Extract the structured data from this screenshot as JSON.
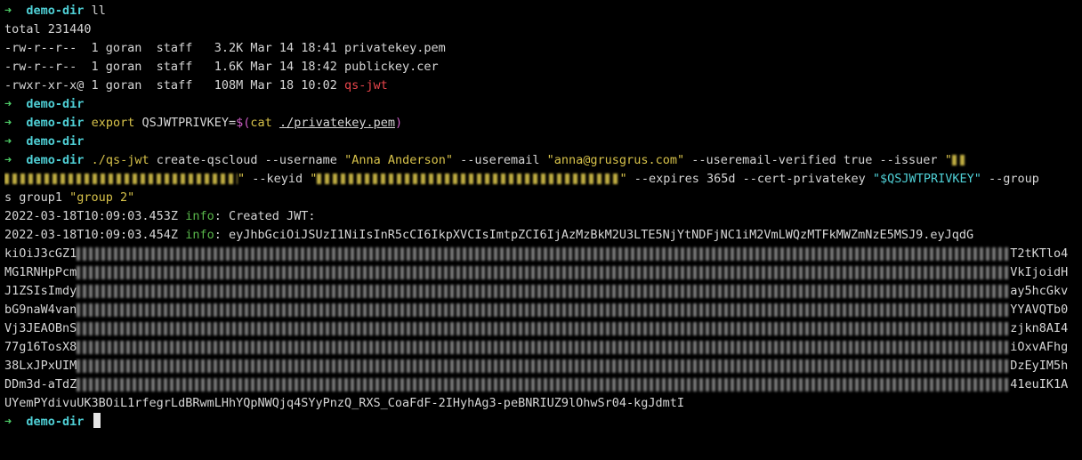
{
  "prompt": {
    "arrow": "➜",
    "dir": "demo-dir"
  },
  "colors": {
    "background": "#000000",
    "prompt_arrow": "#4fd06a",
    "prompt_dir": "#4fd0d6",
    "string": "#d7c24a",
    "variable": "#4fd0d6",
    "executable": "#e8454b",
    "info": "#59b74a"
  },
  "ls": {
    "command": "ll",
    "total": "total 231440",
    "rows": [
      {
        "perm": "-rw-r--r--  1 goran  staff   3.2K Mar 14 18:41 ",
        "name": "privatekey.pem"
      },
      {
        "perm": "-rw-r--r--  1 goran  staff   1.6K Mar 14 18:42 ",
        "name": "publickey.cer"
      },
      {
        "perm": "-rwxr-xr-x@ 1 goran  staff   108M Mar 18 10:02 ",
        "name": "qs-jwt"
      }
    ]
  },
  "export_cmd": {
    "word": "export",
    "assign": " QSJWTPRIVKEY=",
    "subst_open": "$(",
    "cat": "cat",
    "path": "./privatekey.pem",
    "subst_close": ")"
  },
  "qs_cmd": {
    "exe": "./qs-jwt",
    "p1": " create-qscloud --username ",
    "username": "\"Anna Anderson\"",
    "p2": " --useremail ",
    "email": "\"anna@grusgrus.com\"",
    "p3": " --useremail-verified true --issuer ",
    "issuer_open": "\"",
    "issuer_close": "\"",
    "p4": " --keyid ",
    "keyid_open": "\"",
    "keyid_close": "\"",
    "p5": " --expires 365d --cert-privatekey ",
    "var": "\"$QSJWTPRIVKEY\"",
    "p6": " --group",
    "p7": "s group1 ",
    "group2": "\"group 2\""
  },
  "output": {
    "line1_ts": "2022-03-18T10:09:03.453Z ",
    "line1_level": "info",
    "line1_msg": ": Created JWT:",
    "line2_ts": "2022-03-18T10:09:03.454Z ",
    "line2_level": "info",
    "line2_msg": ": eyJhbGciOiJSUzI1NiIsInR5cCI6IkpXVCIsImtpZCI6IjAzMzBkM2U3LTE5NjYtNDFjNC1iM2VmLWQzMTFkMWZmNzE5MSJ9.eyJqdG",
    "jwt_lines": [
      {
        "start": "kiOiJ3cGZ1",
        "end": "T2tKTlo4"
      },
      {
        "start": "MG1RNHpPcm",
        "end": "VkIjoidH"
      },
      {
        "start": "J1ZSIsImdy",
        "end": "ay5hcGkv"
      },
      {
        "start": "bG9naW4van",
        "end": "YYAVQTb0"
      },
      {
        "start": "Vj3JEAOBnS",
        "end": "zjkn8AI4"
      },
      {
        "start": "77g16TosX8",
        "end": "iOxvAFhg"
      },
      {
        "start": "38LxJPxUIM",
        "end": "DzEyIM5h"
      },
      {
        "start": "DDm3d-aTdZ",
        "end": "41euIK1A"
      }
    ],
    "last_line": "UYemPYdivuUK3BOiL1rfegrLdBRwmLHhYQpNWQjq4SYyPnzQ_RXS_CoaFdF-2IHyhAg3-peBNRIUZ9lOhwSr04-kgJdmtI"
  }
}
